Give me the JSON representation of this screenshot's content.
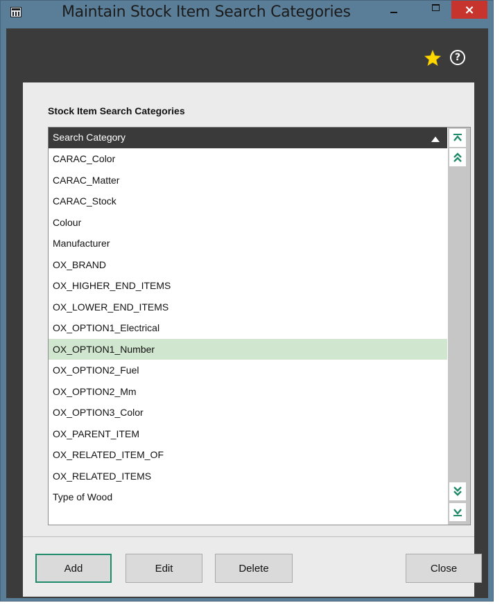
{
  "window": {
    "title": "Maintain Stock Item Search Categories",
    "close_glyph": "×"
  },
  "toolbar": {
    "favorite_icon": "star-icon",
    "help_icon": "help-icon",
    "help_glyph": "?"
  },
  "section": {
    "title": "Stock Item Search Categories"
  },
  "grid": {
    "column_header": "Search Category",
    "sort": "ascending",
    "selected_index": 9,
    "rows": [
      "CARAC_Color",
      "CARAC_Matter",
      "CARAC_Stock",
      "Colour",
      "Manufacturer",
      "OX_BRAND",
      "OX_HIGHER_END_ITEMS",
      "OX_LOWER_END_ITEMS",
      "OX_OPTION1_Electrical",
      "OX_OPTION1_Number",
      "OX_OPTION2_Fuel",
      "OX_OPTION2_Mm",
      "OX_OPTION3_Color",
      "OX_PARENT_ITEM",
      "OX_RELATED_ITEM_OF",
      "OX_RELATED_ITEMS",
      "Type of Wood"
    ]
  },
  "buttons": {
    "add": "Add",
    "edit": "Edit",
    "delete": "Delete",
    "close": "Close"
  },
  "colors": {
    "title_bar": "#5b7e98",
    "close_button": "#c7342e",
    "dark_frame": "#3b3b3b",
    "panel": "#ebebeb",
    "selected_row": "#d1e6cf",
    "scroll_arrow": "#1e8a6a",
    "star": "#ffd700",
    "default_button_border": "#1e8a6a"
  }
}
